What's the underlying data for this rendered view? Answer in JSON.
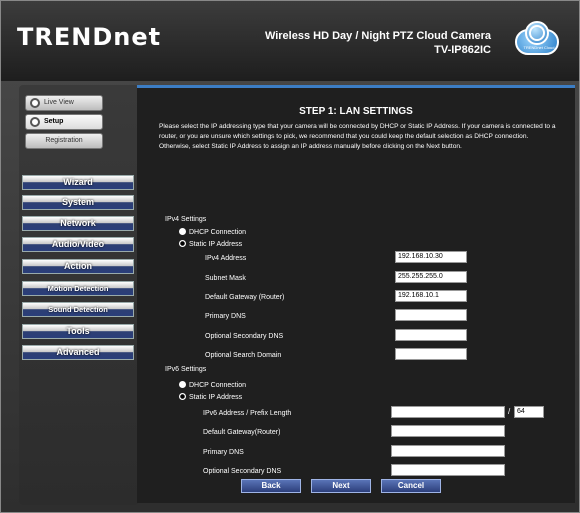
{
  "header": {
    "logo": "TRENDnet",
    "product_line1": "Wireless HD Day / Night PTZ Cloud Camera",
    "product_line2": "TV-IP862IC",
    "cloud_label": "TRENDnet Cloud"
  },
  "sidebar": {
    "live_view": "Live View",
    "setup": "Setup",
    "registration": "Registration",
    "menu": [
      "Wizard",
      "System",
      "Network",
      "Audio/Video",
      "Action",
      "Motion Detection",
      "Sound Detection",
      "Tools",
      "Advanced"
    ]
  },
  "main": {
    "title": "STEP 1: LAN SETTINGS",
    "intro": "Please select the IP addressing type that your camera will be connected by DHCP or Static IP Address. If your camera is connected to a router, or you are unsure which settings to pick, we recommend that you could keep the default selection as DHCP connection. Otherwise, select Static IP Address to assign an IP address manually before clicking on the Next button.",
    "ipv4": {
      "heading": "IPv4 Settings",
      "dhcp": "DHCP Connection",
      "static": "Static IP Address",
      "fields": [
        {
          "label": "IPv4 Address",
          "value": "192.168.10.30"
        },
        {
          "label": "Subnet Mask",
          "value": "255.255.255.0"
        },
        {
          "label": "Default Gateway (Router)",
          "value": "192.168.10.1"
        },
        {
          "label": "Primary DNS",
          "value": ""
        },
        {
          "label": "Optional Secondary DNS",
          "value": ""
        },
        {
          "label": "Optional Search Domain",
          "value": ""
        }
      ]
    },
    "ipv6": {
      "heading": "IPv6 Settings",
      "dhcp": "DHCP Connection",
      "static": "Static IP Address",
      "fields": [
        {
          "label": "IPv6 Address / Prefix Length",
          "value": "",
          "prefix": "64"
        },
        {
          "label": "Default Gateway(Router)",
          "value": ""
        },
        {
          "label": "Primary DNS",
          "value": ""
        },
        {
          "label": "Optional Secondary DNS",
          "value": ""
        }
      ]
    },
    "buttons": {
      "back": "Back",
      "next": "Next",
      "cancel": "Cancel"
    }
  },
  "colors": {
    "accent": "#3c7dc4",
    "menu_blue": "#2d3f73",
    "background": "#1f1f1f"
  }
}
